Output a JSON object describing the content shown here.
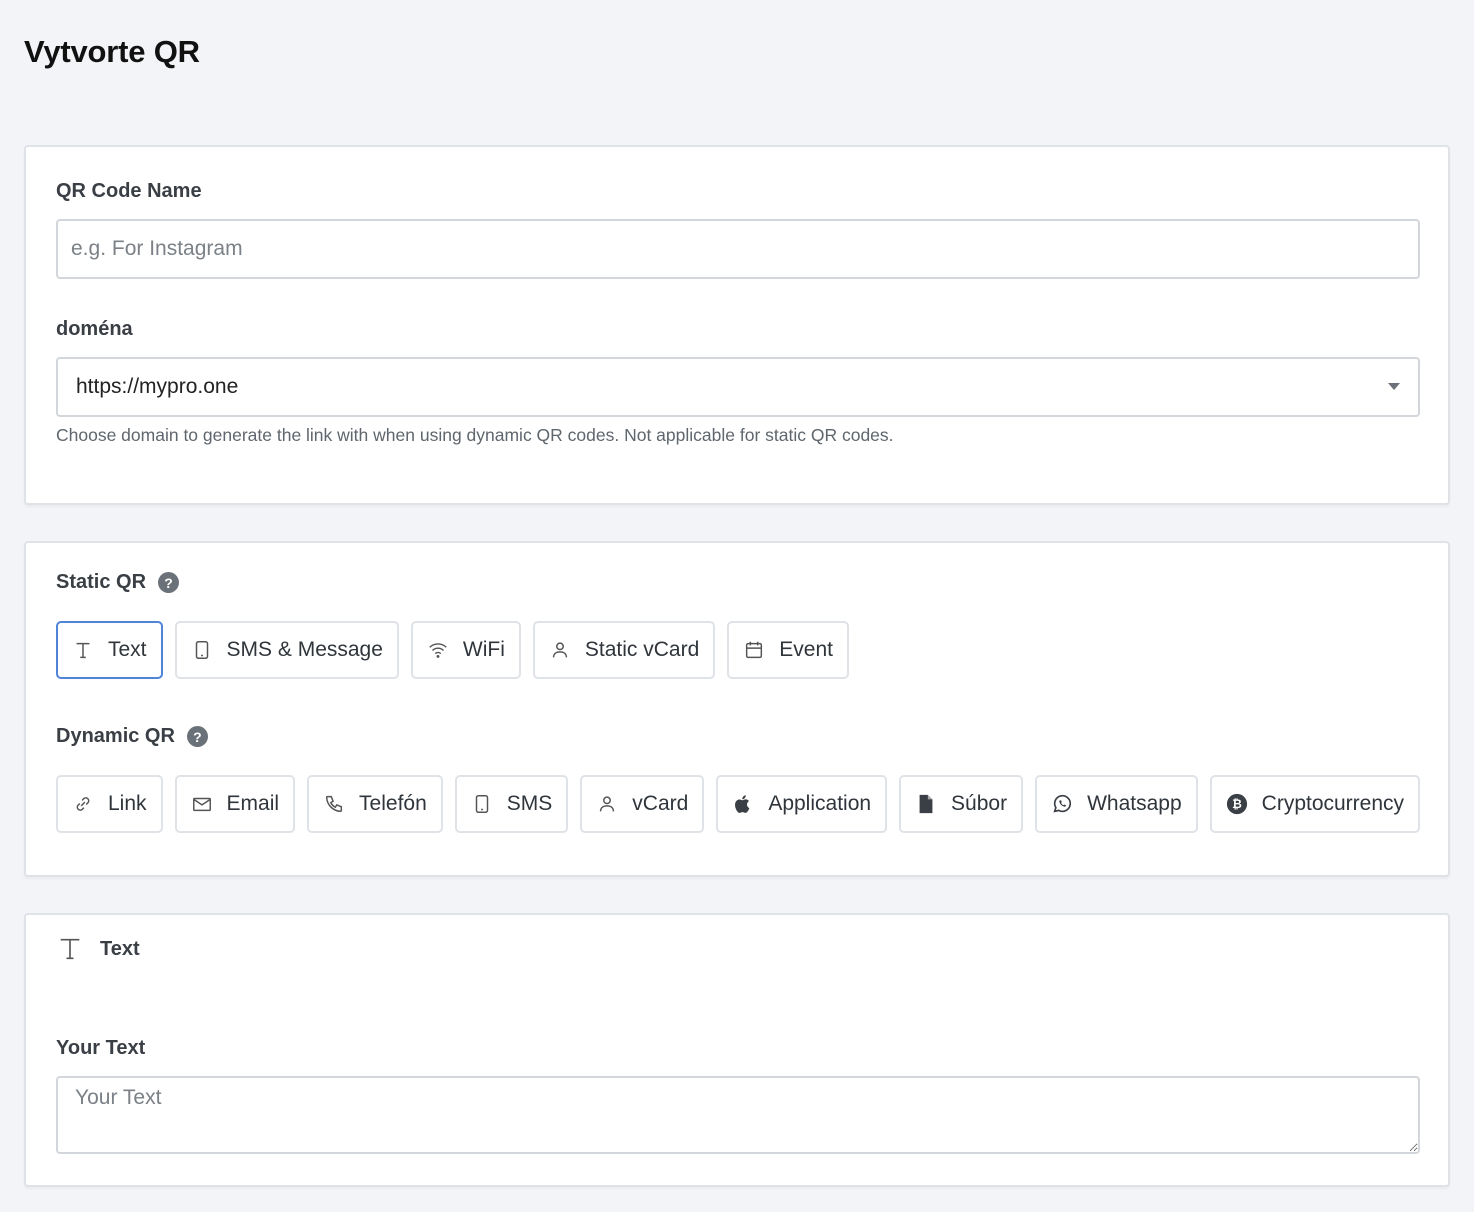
{
  "page": {
    "title": "Vytvorte QR"
  },
  "name_field": {
    "label": "QR Code Name",
    "placeholder": "e.g. For Instagram",
    "value": ""
  },
  "domain_field": {
    "label": "doména",
    "selected": "https://mypro.one",
    "help": "Choose domain to generate the link with when using dynamic QR codes. Not applicable for static QR codes."
  },
  "static_qr": {
    "label": "Static QR",
    "help_icon": "question-circle-icon",
    "options": [
      {
        "label": "Text",
        "icon": "text-icon",
        "active": true
      },
      {
        "label": "SMS & Message",
        "icon": "phone-icon"
      },
      {
        "label": "WiFi",
        "icon": "wifi-icon"
      },
      {
        "label": "Static vCard",
        "icon": "user-icon"
      },
      {
        "label": "Event",
        "icon": "calendar-icon"
      }
    ]
  },
  "dynamic_qr": {
    "label": "Dynamic QR",
    "help_icon": "question-circle-icon",
    "options": [
      {
        "label": "Link",
        "icon": "link-icon"
      },
      {
        "label": "Email",
        "icon": "mail-icon"
      },
      {
        "label": "Telefón",
        "icon": "phone-handset-icon"
      },
      {
        "label": "SMS",
        "icon": "mobile-icon"
      },
      {
        "label": "vCard",
        "icon": "user-icon"
      },
      {
        "label": "Application",
        "icon": "apple-icon"
      },
      {
        "label": "Súbor",
        "icon": "file-icon"
      },
      {
        "label": "Whatsapp",
        "icon": "whatsapp-icon"
      },
      {
        "label": "Cryptocurrency",
        "icon": "bitcoin-icon"
      }
    ]
  },
  "text_section": {
    "title": "Text",
    "icon": "text-icon",
    "field_label": "Your Text",
    "placeholder": "Your Text"
  }
}
